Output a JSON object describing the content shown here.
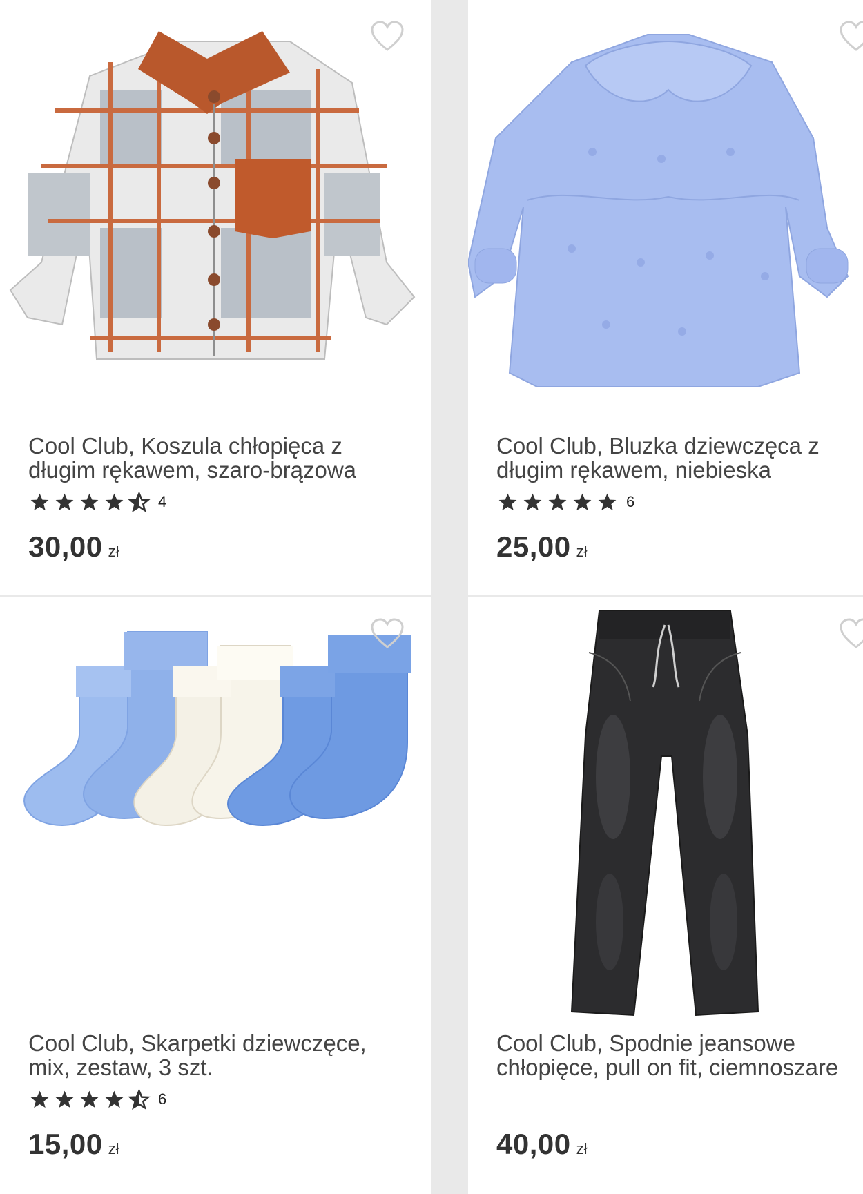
{
  "products": [
    {
      "title": "Cool Club, Koszula chłopięca z długim rękawem, szaro-brązowa",
      "rating_value": 4.5,
      "rating_count": "4",
      "price": "30,00",
      "currency": "zł",
      "image_icon": "plaid-shirt-image"
    },
    {
      "title": "Cool Club, Bluzka dziewczęca z długim rękawem, niebieska",
      "rating_value": 5,
      "rating_count": "6",
      "price": "25,00",
      "currency": "zł",
      "image_icon": "blouse-image"
    },
    {
      "title": "Cool Club, Skarpetki dziewczęce, mix, zestaw, 3 szt.",
      "rating_value": 4.5,
      "rating_count": "6",
      "price": "15,00",
      "currency": "zł",
      "image_icon": "socks-image"
    },
    {
      "title": "Cool Club, Spodnie jeansowe chłopięce, pull on fit, ciemnoszare",
      "rating_value": null,
      "rating_count": null,
      "price": "40,00",
      "currency": "zł",
      "image_icon": "jeans-image"
    }
  ],
  "colors": {
    "star": "#333333",
    "heart_outline": "#cfcfcf",
    "text": "#444444"
  }
}
